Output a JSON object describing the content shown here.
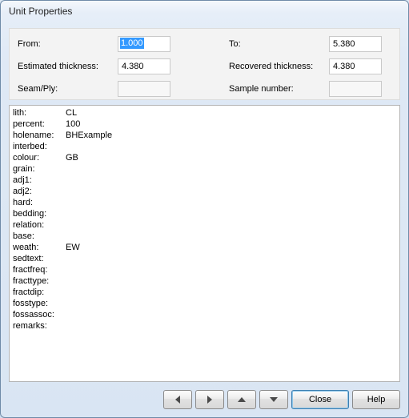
{
  "window": {
    "title": "Unit Properties"
  },
  "form": {
    "from": {
      "label": "From:",
      "value": "1.000"
    },
    "to": {
      "label": "To:",
      "value": "5.380"
    },
    "est": {
      "label": "Estimated thickness:",
      "value": "4.380"
    },
    "rec": {
      "label": "Recovered thickness:",
      "value": "4.380"
    },
    "seam": {
      "label": "Seam/Ply:",
      "value": ""
    },
    "sample": {
      "label": "Sample number:",
      "value": ""
    }
  },
  "details": [
    {
      "key": "lith:",
      "value": "CL"
    },
    {
      "key": "percent:",
      "value": "100"
    },
    {
      "key": "holename:",
      "value": "BHExample"
    },
    {
      "key": "interbed:",
      "value": ""
    },
    {
      "key": "colour:",
      "value": "GB"
    },
    {
      "key": "grain:",
      "value": ""
    },
    {
      "key": "adj1:",
      "value": ""
    },
    {
      "key": "adj2:",
      "value": ""
    },
    {
      "key": "hard:",
      "value": ""
    },
    {
      "key": "bedding:",
      "value": ""
    },
    {
      "key": "relation:",
      "value": ""
    },
    {
      "key": "base:",
      "value": ""
    },
    {
      "key": "weath:",
      "value": "EW"
    },
    {
      "key": "sedtext:",
      "value": ""
    },
    {
      "key": "fractfreq:",
      "value": ""
    },
    {
      "key": "fracttype:",
      "value": ""
    },
    {
      "key": "fractdip:",
      "value": ""
    },
    {
      "key": "fosstype:",
      "value": ""
    },
    {
      "key": "fossassoc:",
      "value": ""
    },
    {
      "key": "remarks:",
      "value": ""
    }
  ],
  "buttons": {
    "close": "Close",
    "help": "Help"
  }
}
